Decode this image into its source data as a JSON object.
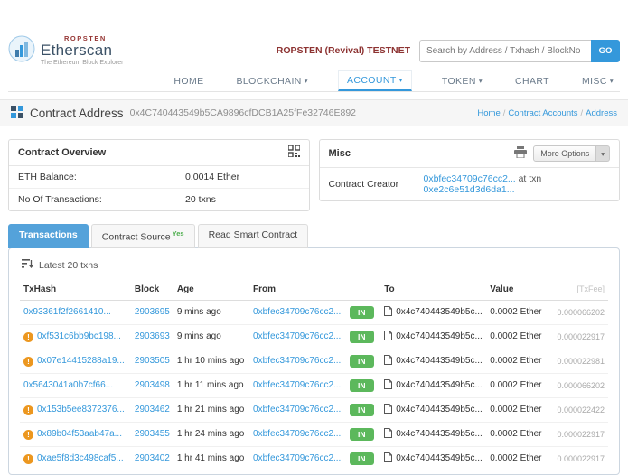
{
  "header": {
    "brand": {
      "network_badge": "ROPSTEN",
      "name": "Etherscan",
      "tagline": "The Ethereum Block Explorer"
    },
    "testnet_label": "ROPSTEN (Revival) TESTNET",
    "search": {
      "placeholder": "Search by Address / Txhash / BlockNo",
      "go_label": "GO"
    },
    "nav": [
      {
        "label": "HOME"
      },
      {
        "label": "BLOCKCHAIN"
      },
      {
        "label": "ACCOUNT"
      },
      {
        "label": "TOKEN"
      },
      {
        "label": "CHART"
      },
      {
        "label": "MISC"
      }
    ]
  },
  "page": {
    "title": "Contract Address",
    "address": "0x4C740443549b5CA9896cfDCB1A25fFe32746E892",
    "breadcrumb": [
      "Home",
      "Contract Accounts",
      "Address"
    ]
  },
  "overview": {
    "title": "Contract Overview",
    "rows": [
      {
        "label": "ETH Balance:",
        "value": "0.0014 Ether"
      },
      {
        "label": "No Of Transactions:",
        "value": "20 txns"
      }
    ]
  },
  "misc": {
    "title": "Misc",
    "more_options": "More Options",
    "creator_label": "Contract Creator",
    "creator_address": "0xbfec34709c76cc2...",
    "creator_mid": "at txn",
    "creator_txn": "0xe2c6e51d3d6da1..."
  },
  "tabs": [
    {
      "label": "Transactions"
    },
    {
      "label": "Contract Source",
      "sup": "Yes"
    },
    {
      "label": "Read Smart Contract"
    }
  ],
  "table": {
    "latest_label": "Latest 20 txns",
    "headers": [
      "TxHash",
      "Block",
      "Age",
      "From",
      "",
      "To",
      "Value",
      "[TxFee]"
    ],
    "rows": [
      {
        "warn": false,
        "txhash": "0x93361f2f2661410...",
        "block": "2903695",
        "age": "9 mins ago",
        "from": "0xbfec34709c76cc2...",
        "dir": "IN",
        "to": "0x4c740443549b5c...",
        "value": "0.0002 Ether",
        "txfee": "0.000066202"
      },
      {
        "warn": true,
        "txhash": "0xf531c6bb9bc198...",
        "block": "2903693",
        "age": "9 mins ago",
        "from": "0xbfec34709c76cc2...",
        "dir": "IN",
        "to": "0x4c740443549b5c...",
        "value": "0.0002 Ether",
        "txfee": "0.000022917"
      },
      {
        "warn": true,
        "txhash": "0x07e14415288a19...",
        "block": "2903505",
        "age": "1 hr 10 mins ago",
        "from": "0xbfec34709c76cc2...",
        "dir": "IN",
        "to": "0x4c740443549b5c...",
        "value": "0.0002 Ether",
        "txfee": "0.000022981"
      },
      {
        "warn": false,
        "txhash": "0x5643041a0b7cf66...",
        "block": "2903498",
        "age": "1 hr 11 mins ago",
        "from": "0xbfec34709c76cc2...",
        "dir": "IN",
        "to": "0x4c740443549b5c...",
        "value": "0.0002 Ether",
        "txfee": "0.000066202"
      },
      {
        "warn": true,
        "txhash": "0x153b5ee8372376...",
        "block": "2903462",
        "age": "1 hr 21 mins ago",
        "from": "0xbfec34709c76cc2...",
        "dir": "IN",
        "to": "0x4c740443549b5c...",
        "value": "0.0002 Ether",
        "txfee": "0.000022422"
      },
      {
        "warn": true,
        "txhash": "0x89b04f53aab47a...",
        "block": "2903455",
        "age": "1 hr 24 mins ago",
        "from": "0xbfec34709c76cc2...",
        "dir": "IN",
        "to": "0x4c740443549b5c...",
        "value": "0.0002 Ether",
        "txfee": "0.000022917"
      },
      {
        "warn": true,
        "txhash": "0xae5f8d3c498caf5...",
        "block": "2903402",
        "age": "1 hr 41 mins ago",
        "from": "0xbfec34709c76cc2...",
        "dir": "IN",
        "to": "0x4c740443549b5c...",
        "value": "0.0002 Ether",
        "txfee": "0.000022917"
      }
    ]
  }
}
